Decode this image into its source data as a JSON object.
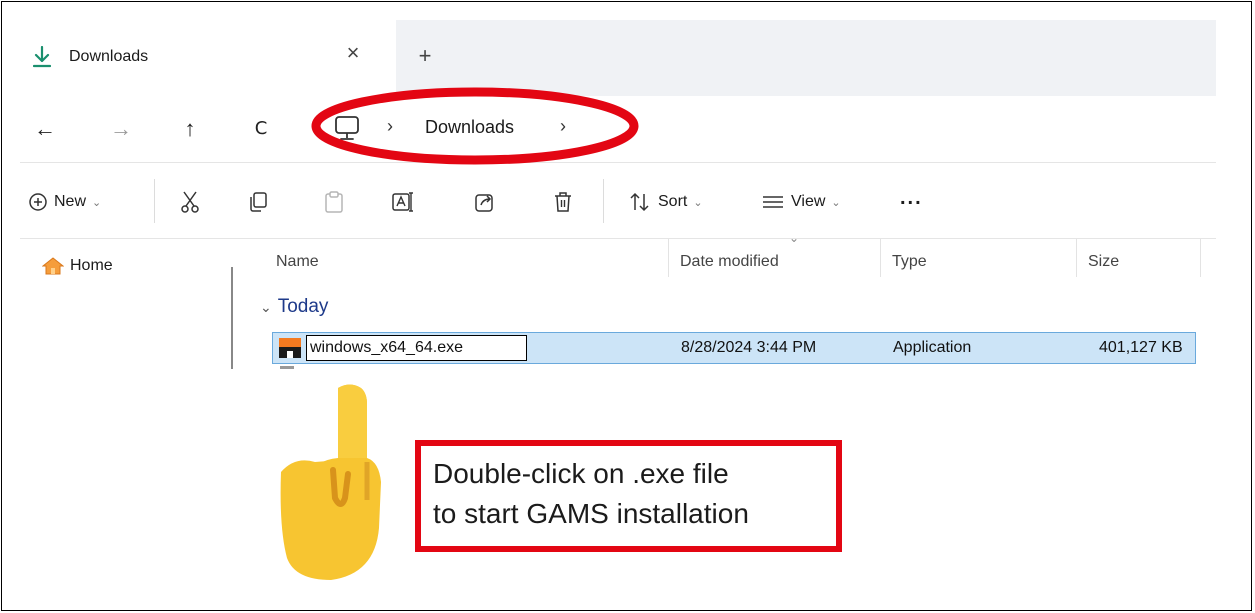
{
  "tab": {
    "title": "Downloads",
    "close": "×",
    "new_tab": "+"
  },
  "nav": {
    "back": "←",
    "forward": "→",
    "up": "↑",
    "refresh": "C"
  },
  "breadcrumb": {
    "sep": "›",
    "location": "Downloads"
  },
  "toolbar": {
    "new_label": "New",
    "sort_label": "Sort",
    "view_label": "View",
    "more_label": "...",
    "chevron": "⌄"
  },
  "nav_pane": {
    "home_label": "Home"
  },
  "columns": {
    "name": "Name",
    "date": "Date modified",
    "type": "Type",
    "size": "Size"
  },
  "group": {
    "label": "Today",
    "chevron": "⌄"
  },
  "file": {
    "name": "windows_x64_64.exe",
    "date": "8/28/2024 3:44 PM",
    "type": "Application",
    "size": "401,127 KB"
  },
  "annotation": {
    "line1": "Double-click on .exe file",
    "line2": "to start GAMS installation",
    "callout_color": "#e30613",
    "hand_color": "#f7c531"
  },
  "icons": [
    "download-icon",
    "close-icon",
    "plus-icon",
    "back-icon",
    "forward-icon",
    "up-icon",
    "refresh-icon",
    "pc-icon",
    "new-icon",
    "cut-icon",
    "copy-icon",
    "paste-icon",
    "rename-icon",
    "share-icon",
    "delete-icon",
    "sort-icon",
    "view-icon",
    "home-icon",
    "exe-icon",
    "pointing-hand-icon"
  ]
}
